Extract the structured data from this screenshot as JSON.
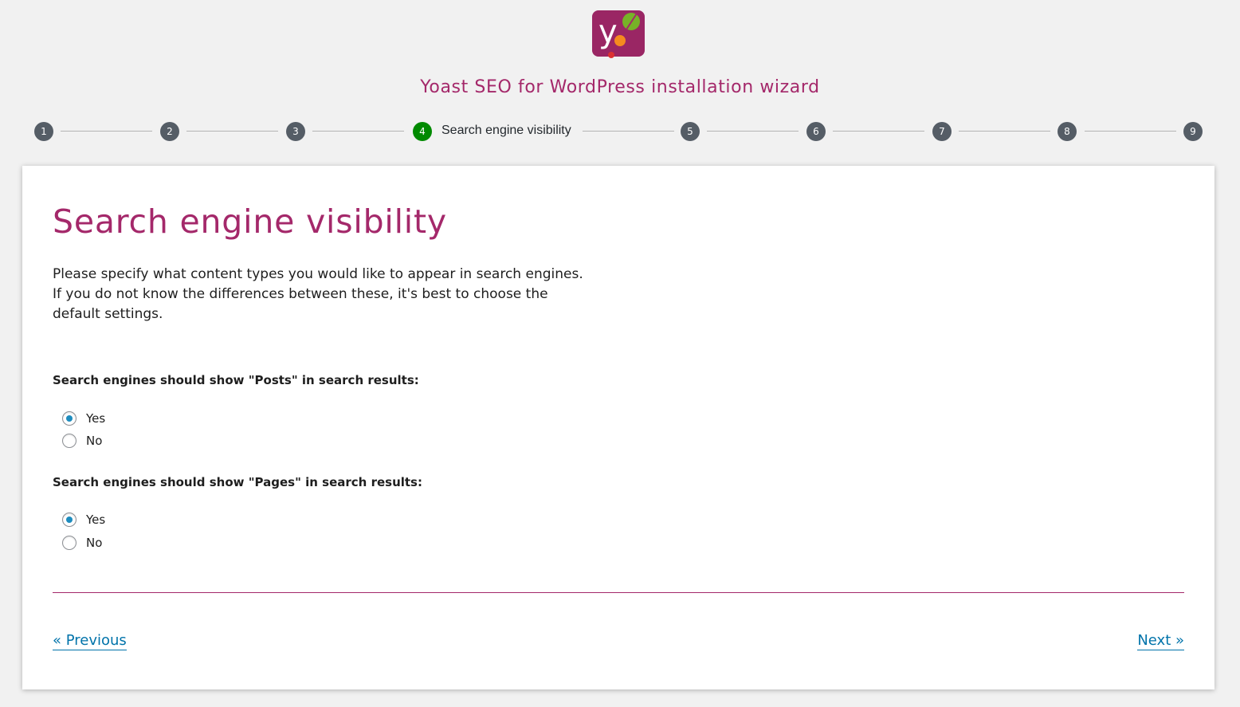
{
  "header": {
    "logo_icon": "yoast-logo-icon",
    "title": "Yoast SEO for WordPress installation wizard"
  },
  "stepper": {
    "steps": [
      {
        "number": "1",
        "label": ""
      },
      {
        "number": "2",
        "label": ""
      },
      {
        "number": "3",
        "label": ""
      },
      {
        "number": "4",
        "label": "Search engine visibility",
        "active": true
      },
      {
        "number": "5",
        "label": ""
      },
      {
        "number": "6",
        "label": ""
      },
      {
        "number": "7",
        "label": ""
      },
      {
        "number": "8",
        "label": ""
      },
      {
        "number": "9",
        "label": ""
      }
    ],
    "active_color": "#008a00",
    "inactive_color": "#555d66"
  },
  "main": {
    "title": "Search engine visibility",
    "intro_lines": [
      "Please specify what content types you would like to appear in search engines.",
      "If you do not know the differences between these, it's best to choose the",
      "default settings."
    ],
    "questions": [
      {
        "label": "Search engines should show \"Posts\" in search results:",
        "options": [
          {
            "label": "Yes",
            "checked": true
          },
          {
            "label": "No",
            "checked": false
          }
        ]
      },
      {
        "label": "Search engines should show \"Pages\" in search results:",
        "options": [
          {
            "label": "Yes",
            "checked": true
          },
          {
            "label": "No",
            "checked": false
          }
        ]
      }
    ]
  },
  "footer": {
    "previous_label": "« Previous",
    "next_label": "Next »"
  },
  "colors": {
    "brand": "#a4286a",
    "link": "#0073aa",
    "radio_checked": "#1e8cbe",
    "page_background": "#f1f1f1"
  }
}
